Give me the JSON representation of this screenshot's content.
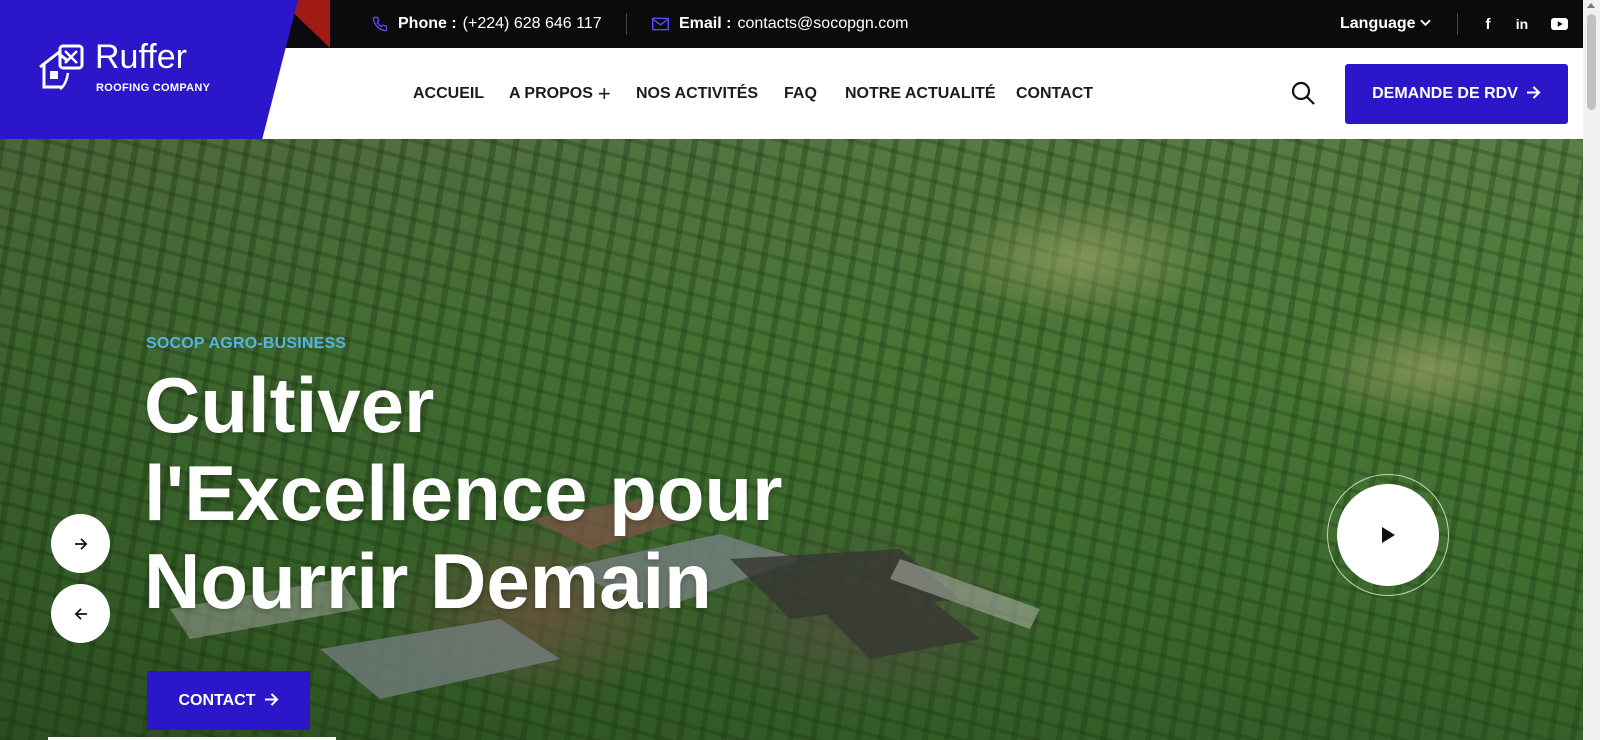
{
  "topbar": {
    "phone_label": "Phone :",
    "phone_value": "(+224) 628 646 117",
    "email_label": "Email :",
    "email_value": "contacts@socopgn.com",
    "language_label": "Language",
    "social": [
      "facebook-icon",
      "linkedin-icon",
      "youtube-icon"
    ],
    "facebook_glyph": "f",
    "linkedin_glyph": "in"
  },
  "brand": {
    "name": "Ruffer",
    "subtitle": "ROOFING COMPANY",
    "accent_color": "#2b16c9",
    "red_accent": "#a01b16"
  },
  "nav": {
    "items": [
      {
        "label": "ACCUEIL"
      },
      {
        "label": "A PROPOS"
      },
      {
        "label": "NOS ACTIVITÉS"
      },
      {
        "label": "FAQ"
      },
      {
        "label": "NOTRE ACTUALITÉ"
      },
      {
        "label": "CONTACT"
      }
    ],
    "apropos_plus": "+",
    "cta_label": "DEMANDE DE RDV"
  },
  "hero": {
    "tagline": "SOCOP AGRO-BUSINESS",
    "title_line1": "Cultiver",
    "title_line2": "l'Excellence pour",
    "title_line3": "Nourrir Demain",
    "cta_label": "CONTACT",
    "tag_color": "#57b3e0"
  }
}
